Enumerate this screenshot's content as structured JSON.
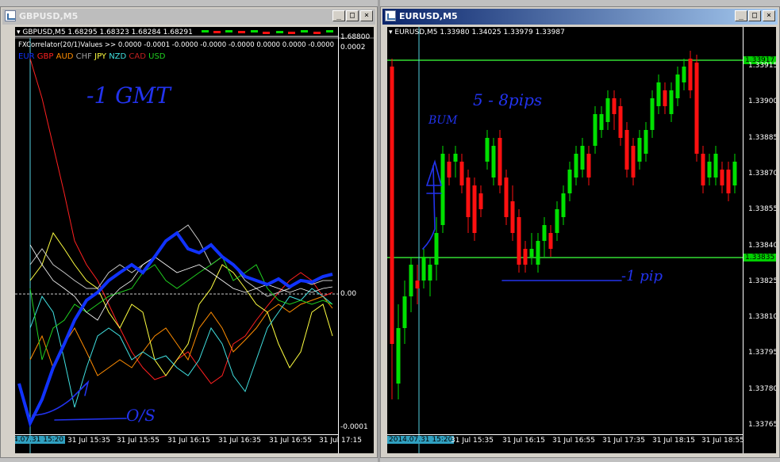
{
  "colors": {
    "bull": "#00e000",
    "bear": "#ff1010",
    "hline": "#33dd33",
    "cursor": "#55d0e0",
    "annotation": "#2233ee",
    "strength_thick": "#1133ff"
  },
  "left_window": {
    "title": "GBPUSD,M5",
    "icon": "chart-window-icon",
    "symbol_line": "GBPUSD,M5  1.68295 1.68323 1.68284 1.68291",
    "indicator_line": "FXCorrelator(20/1)Values >> 0.0000 -0.0001 -0.0000 -0.0000 -0.0000 0.0000 0.0000 -0.0000",
    "currencies": [
      {
        "name": "EUR",
        "color": "#1133ff"
      },
      {
        "name": "GBP",
        "color": "#ff2020"
      },
      {
        "name": "AUD",
        "color": "#ff8c00"
      },
      {
        "name": "CHF",
        "color": "#a0a0a0"
      },
      {
        "name": "JPY",
        "color": "#ffff40"
      },
      {
        "name": "NZD",
        "color": "#40e0e0"
      },
      {
        "name": "CAD",
        "color": "#c02020"
      },
      {
        "name": "USD",
        "color": "#20d020"
      }
    ],
    "price_axis_top": "1.68800",
    "axis_labels": [
      "0.0002",
      "0.00",
      "-0.0001"
    ],
    "time_box": "4.07.31 15:20",
    "time_labels": [
      "31 Jul 15:35",
      "31 Jul 15:55",
      "31 Jul 16:15",
      "31 Jul 16:35",
      "31 Jul 16:55",
      "31 Jul 17:15"
    ],
    "buttons": [
      "_",
      "□",
      "×"
    ]
  },
  "right_window": {
    "title": "EURUSD,M5",
    "icon": "chart-window-icon",
    "symbol_line": "EURUSD,M5  1.33980 1.34025 1.33979 1.33987",
    "price_labels": [
      "1.33915",
      "1.33900",
      "1.33885",
      "1.33870",
      "1.33855",
      "1.33840",
      "1.33825",
      "1.33810",
      "1.33795",
      "1.33780",
      "1.33765"
    ],
    "upper_line_price": "1.33917",
    "lower_line_price": "1.33835",
    "time_box": "2014.07.31 15:20",
    "time_labels": [
      "31 Jul 15:35",
      "31 Jul 16:15",
      "31 Jul 16:55",
      "31 Jul 17:35",
      "31 Jul 18:15",
      "31 Jul 18:55"
    ],
    "buttons": [
      "_",
      "□",
      "×"
    ]
  },
  "annotations": {
    "gmt": "-1 GMT",
    "os": "O/S",
    "pips": "5 - 8pips",
    "bum": "BUM",
    "one_pip": "-1 pip"
  }
}
